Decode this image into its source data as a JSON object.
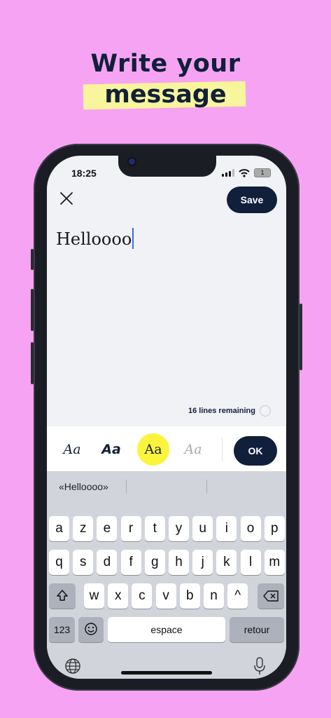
{
  "headline": {
    "line1": "Write your",
    "line2": "message"
  },
  "status": {
    "time": "18:25",
    "battery": "1"
  },
  "editor": {
    "save_label": "Save",
    "message_text": "Helloooo",
    "lines_remaining": "16 lines remaining"
  },
  "fonts": {
    "options": [
      "Aa",
      "Aa",
      "Aa",
      "Aa"
    ],
    "selected_index": 2,
    "ok_label": "OK",
    "highlight_color": "#fbf43c"
  },
  "keyboard": {
    "suggestion": "«Helloooo»",
    "row1": [
      "a",
      "z",
      "e",
      "r",
      "t",
      "y",
      "u",
      "i",
      "o",
      "p"
    ],
    "row2": [
      "q",
      "s",
      "d",
      "f",
      "g",
      "h",
      "j",
      "k",
      "l",
      "m"
    ],
    "row3": [
      "w",
      "x",
      "c",
      "v",
      "b",
      "n",
      "^"
    ],
    "numbers_label": "123",
    "space_label": "espace",
    "return_label": "retour"
  },
  "colors": {
    "background": "#f7a3f3",
    "navy": "#10203a",
    "highlight": "#f8f59c"
  }
}
